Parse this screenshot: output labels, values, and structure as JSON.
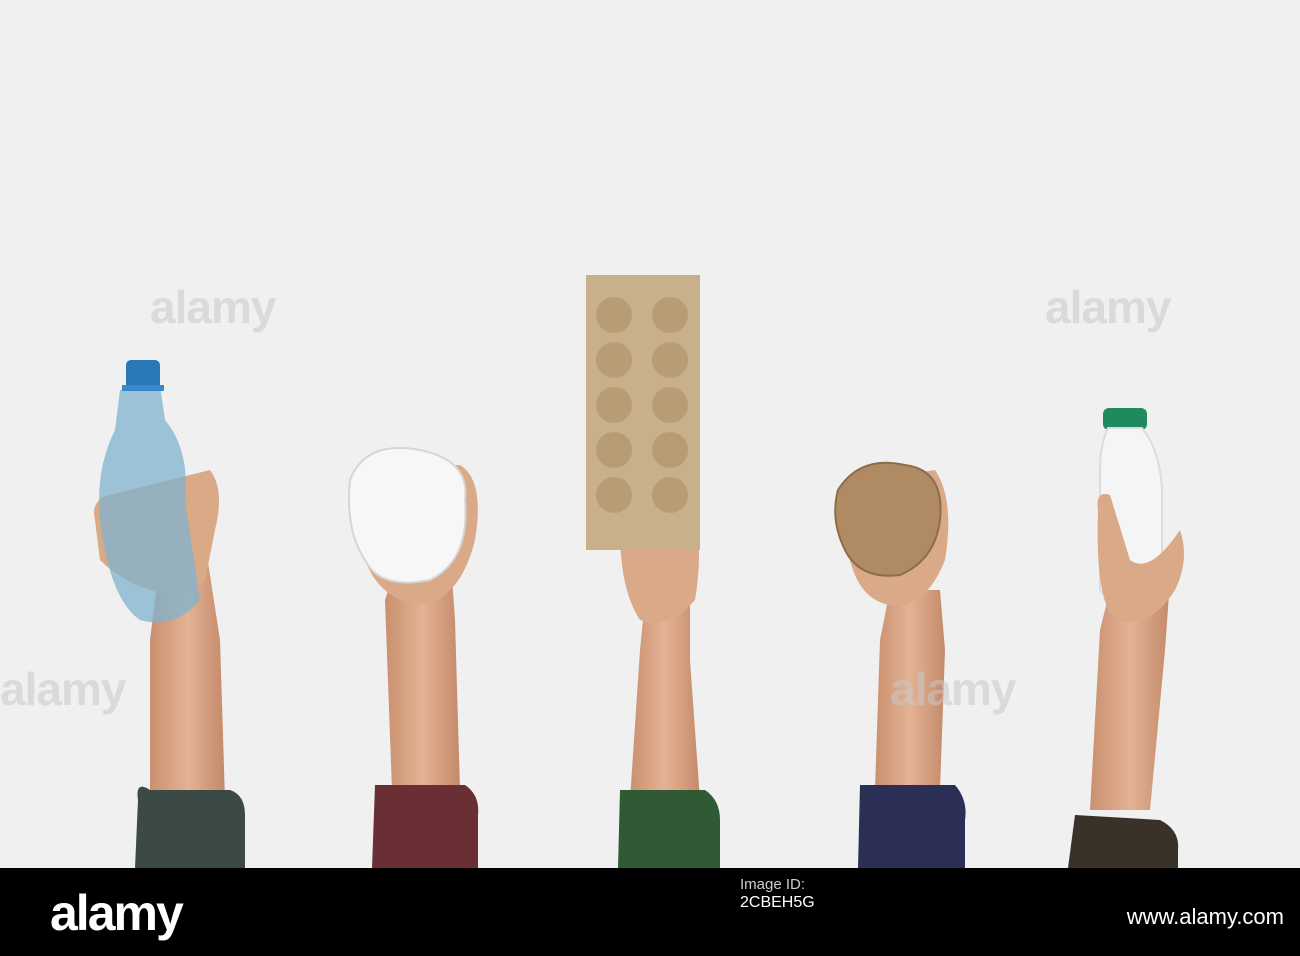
{
  "photo": {
    "description_alt": "",
    "colors": {
      "background": "#f0f0f0",
      "skin": "#d9a988",
      "sleeve1": "#3b4a44",
      "sleeve2": "#6a2f34",
      "sleeve3": "#2f5a35",
      "sleeve4": "#2b2f55",
      "sleeve5": "#3a3128"
    },
    "watermark": "alamy"
  },
  "footer": {
    "brand": "alamy",
    "image_id_label": "Image ID:",
    "image_id": "2CBEH5G",
    "url": "www.alamy.com"
  }
}
